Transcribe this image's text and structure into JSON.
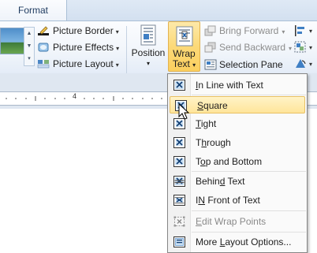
{
  "tabs": {
    "active": "Format"
  },
  "picture_styles": {
    "items": [
      {
        "label": "Picture Border",
        "icon": "pen-border-icon"
      },
      {
        "label": "Picture Effects",
        "icon": "picture-effects-icon"
      },
      {
        "label": "Picture Layout",
        "icon": "picture-layout-icon"
      }
    ]
  },
  "arrange": {
    "position_label": "Position",
    "wrap_label_line1": "Wrap",
    "wrap_label_line2": "Text",
    "bring_forward": "Bring Forward",
    "send_backward": "Send Backward",
    "selection_pane": "Selection Pane"
  },
  "ruler": {
    "mark": "4"
  },
  "wrap_menu": {
    "items": [
      {
        "label": "In Line with Text",
        "mnemonic": "I",
        "rest": "n Line with Text",
        "icon": "inline-with-text-icon",
        "state": "normal"
      },
      {
        "label": "Square",
        "mnemonic": "S",
        "rest": "quare",
        "icon": "square-wrap-icon",
        "state": "hover"
      },
      {
        "label": "Tight",
        "mnemonic": "T",
        "rest": "ight",
        "icon": "tight-wrap-icon",
        "state": "normal"
      },
      {
        "label": "Through",
        "mnemonic": "h",
        "pre": "T",
        "rest": "rough",
        "icon": "through-wrap-icon",
        "state": "normal"
      },
      {
        "label": "Top and Bottom",
        "mnemonic": "o",
        "pre": "T",
        "rest": "p and Bottom",
        "icon": "top-bottom-wrap-icon",
        "state": "normal"
      },
      {
        "label": "Behind Text",
        "mnemonic": "d",
        "pre": "Behin",
        "rest": " Text",
        "icon": "behind-text-icon",
        "state": "normal"
      },
      {
        "label": "In Front of Text",
        "mnemonic": "N",
        "pre": "I",
        "rest": " Front of Text",
        "icon": "in-front-of-text-icon",
        "state": "normal"
      },
      {
        "label": "Edit Wrap Points",
        "mnemonic": "E",
        "rest": "dit Wrap Points",
        "icon": "edit-wrap-points-icon",
        "state": "disabled"
      },
      {
        "label": "More Layout Options...",
        "mnemonic": "L",
        "pre": "More ",
        "rest": "ayout Options...",
        "icon": "more-layout-options-icon",
        "state": "normal"
      }
    ]
  }
}
